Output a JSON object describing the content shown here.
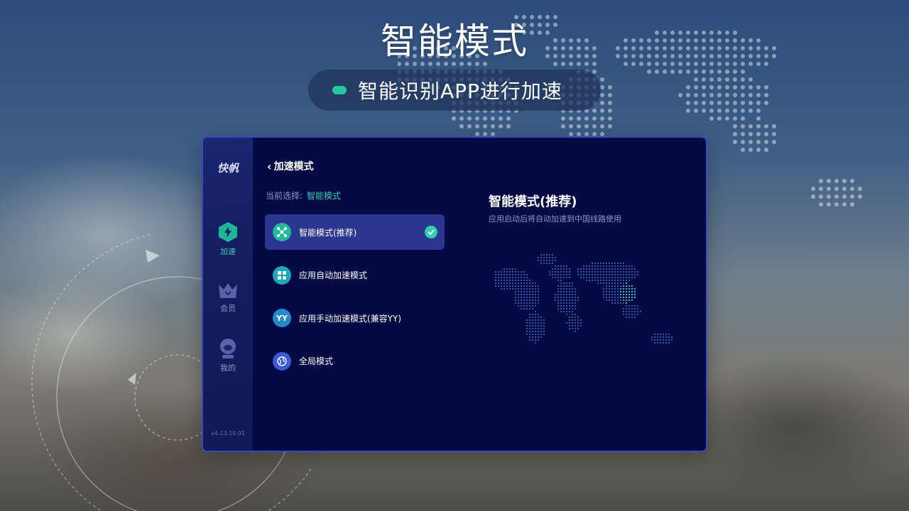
{
  "headline": "智能模式",
  "pill": {
    "text": "智能识别APP进行加速",
    "dot_color": "#27c6a0"
  },
  "app": {
    "brand": "快帆",
    "version": "v4.13.10.01",
    "nav": [
      {
        "label": "加速",
        "icon": "lightning-hexagon-icon",
        "active": true
      },
      {
        "label": "会员",
        "icon": "crown-icon",
        "active": false
      },
      {
        "label": "我的",
        "icon": "user-icon",
        "active": false
      }
    ],
    "page_title": "加速模式",
    "current_label": "当前选择:",
    "current_value": "智能模式",
    "options": [
      {
        "label": "智能模式(推荐)",
        "icon": "smart-network-icon",
        "icon_color": "#22b99a",
        "selected": true
      },
      {
        "label": "应用自动加速模式",
        "icon": "apps-grid-icon",
        "icon_color": "#1aa9b8",
        "selected": false
      },
      {
        "label": "应用手动加速模式(兼容YY)",
        "icon": "yy-icon",
        "icon_text": "YY",
        "icon_color": "#2689c9",
        "selected": false
      },
      {
        "label": "全局模式",
        "icon": "globe-icon",
        "icon_color": "#3b5bd6",
        "selected": false
      }
    ],
    "detail": {
      "title": "智能模式(推荐)",
      "subtitle": "应用启动后将自动加速到中国线路使用"
    },
    "accent_color": "#2fd0ad"
  }
}
